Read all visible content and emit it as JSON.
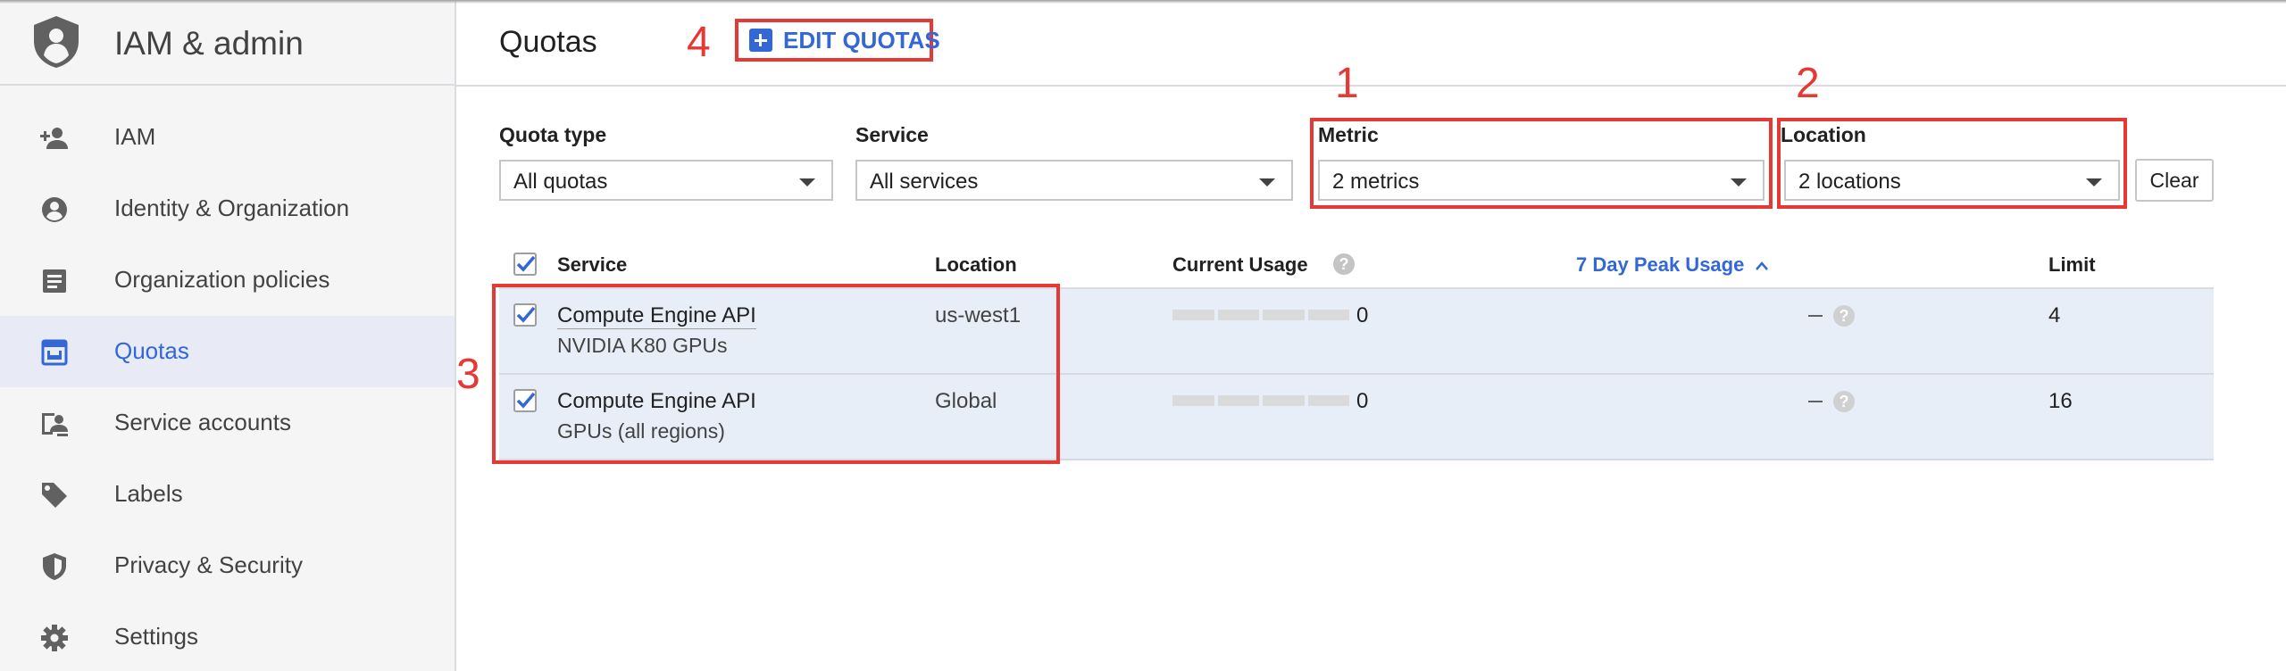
{
  "sidebar": {
    "title": "IAM & admin",
    "items": [
      {
        "label": "IAM",
        "icon": "person-add-icon",
        "active": false
      },
      {
        "label": "Identity & Organization",
        "icon": "account-circle-icon",
        "active": false
      },
      {
        "label": "Organization policies",
        "icon": "policy-document-icon",
        "active": false
      },
      {
        "label": "Quotas",
        "icon": "quota-icon",
        "active": true
      },
      {
        "label": "Service accounts",
        "icon": "service-account-icon",
        "active": false
      },
      {
        "label": "Labels",
        "icon": "label-tag-icon",
        "active": false
      },
      {
        "label": "Privacy & Security",
        "icon": "shield-icon",
        "active": false
      },
      {
        "label": "Settings",
        "icon": "gear-icon",
        "active": false
      }
    ]
  },
  "header": {
    "title": "Quotas",
    "edit_button": "EDIT QUOTAS"
  },
  "annotations": {
    "metric": "1",
    "location": "2",
    "rows": "3",
    "edit": "4"
  },
  "filters": {
    "quota_type": {
      "label": "Quota type",
      "value": "All quotas"
    },
    "service": {
      "label": "Service",
      "value": "All services"
    },
    "metric": {
      "label": "Metric",
      "value": "2 metrics"
    },
    "location": {
      "label": "Location",
      "value": "2 locations"
    },
    "clear": "Clear"
  },
  "table": {
    "columns": {
      "service": "Service",
      "location": "Location",
      "current_usage": "Current Usage",
      "peak_usage": "7 Day Peak Usage",
      "limit": "Limit"
    },
    "rows": [
      {
        "service": "Compute Engine API",
        "metric": "NVIDIA K80 GPUs",
        "location": "us-west1",
        "usage_value": "0",
        "usage_fraction": 0,
        "peak": "—",
        "limit": "4",
        "checked": true
      },
      {
        "service": "Compute Engine API",
        "metric": "GPUs (all regions)",
        "location": "Global",
        "usage_value": "0",
        "usage_fraction": 0,
        "peak": "—",
        "limit": "16",
        "checked": true
      }
    ]
  },
  "colors": {
    "accent": "#3367d6",
    "annotation_red": "#e53935",
    "row_highlight": "#e8eef8"
  }
}
